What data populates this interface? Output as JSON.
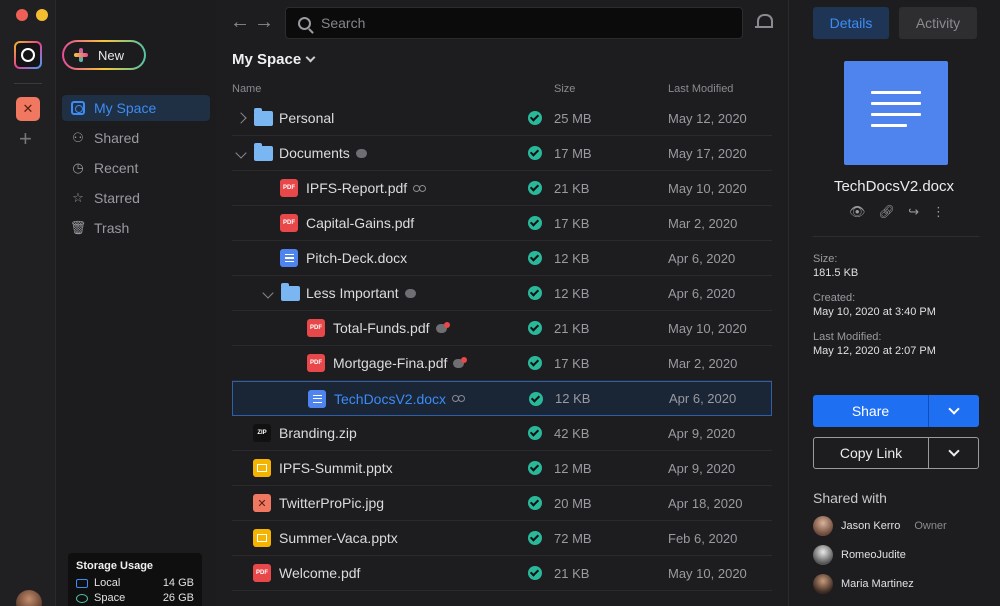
{
  "window": {
    "traffic_colors": [
      "#ee5f57",
      "#f4bd2f",
      "#30c84a"
    ]
  },
  "sidebar": {
    "new_label": "New",
    "items": [
      {
        "label": "My Space",
        "icon": "my-space-icon",
        "active": true
      },
      {
        "label": "Shared",
        "icon": "people-icon",
        "active": false
      },
      {
        "label": "Recent",
        "icon": "clock-icon",
        "active": false
      },
      {
        "label": "Starred",
        "icon": "star-icon",
        "active": false
      },
      {
        "label": "Trash",
        "icon": "trash-icon",
        "active": false
      }
    ],
    "storage": {
      "title": "Storage Usage",
      "rows": [
        {
          "label": "Local",
          "value": "14 GB"
        },
        {
          "label": "Space",
          "value": "26 GB"
        }
      ]
    }
  },
  "toolbar": {
    "search_placeholder": "Search"
  },
  "breadcrumb": {
    "title": "My Space"
  },
  "columns": {
    "name": "Name",
    "size": "Size",
    "modified": "Last Modified"
  },
  "files": [
    {
      "name": "Personal",
      "type": "folder",
      "indent": 0,
      "twisty": "closed",
      "size": "25 MB",
      "modified": "May 12, 2020"
    },
    {
      "name": "Documents",
      "type": "folder",
      "indent": 0,
      "twisty": "open",
      "badge": "comment",
      "size": "17 MB",
      "modified": "May 17, 2020"
    },
    {
      "name": "IPFS-Report.pdf",
      "type": "pdf",
      "indent": 1,
      "badge": "shared",
      "size": "21 KB",
      "modified": "May 10, 2020"
    },
    {
      "name": "Capital-Gains.pdf",
      "type": "pdf",
      "indent": 1,
      "size": "17 KB",
      "modified": "Mar 2, 2020"
    },
    {
      "name": "Pitch-Deck.docx",
      "type": "doc",
      "indent": 1,
      "size": "12 KB",
      "modified": "Apr 6, 2020"
    },
    {
      "name": "Less Important",
      "type": "folder",
      "indent": 1,
      "twisty": "open",
      "badge": "comment",
      "size": "12 KB",
      "modified": "Apr 6, 2020"
    },
    {
      "name": "Total-Funds.pdf",
      "type": "pdf",
      "indent": 2,
      "badge": "comment-alert",
      "size": "21 KB",
      "modified": "May 10, 2020"
    },
    {
      "name": "Mortgage-Fina.pdf",
      "type": "pdf",
      "indent": 2,
      "badge": "comment-alert",
      "size": "17 KB",
      "modified": "Mar 2, 2020"
    },
    {
      "name": "TechDocsV2.docx",
      "type": "doc",
      "indent": 2,
      "badge": "shared",
      "selected": true,
      "size": "12 KB",
      "modified": "Apr 6, 2020"
    },
    {
      "name": "Branding.zip",
      "type": "zip",
      "indent": 0,
      "size": "42 KB",
      "modified": "Apr 9, 2020"
    },
    {
      "name": "IPFS-Summit.pptx",
      "type": "ppt",
      "indent": 0,
      "size": "12 MB",
      "modified": "Apr 9, 2020"
    },
    {
      "name": "TwitterProPic.jpg",
      "type": "img",
      "indent": 0,
      "size": "20 MB",
      "modified": "Apr 18, 2020"
    },
    {
      "name": "Summer-Vaca.pptx",
      "type": "ppt",
      "indent": 0,
      "size": "72 MB",
      "modified": "Feb 6, 2020"
    },
    {
      "name": "Welcome.pdf",
      "type": "pdf",
      "indent": 0,
      "size": "21 KB",
      "modified": "May 10, 2020"
    }
  ],
  "details": {
    "tabs": {
      "details": "Details",
      "activity": "Activity"
    },
    "file_name": "TechDocsV2.docx",
    "size_label": "Size:",
    "size_value": "181.5 KB",
    "created_label": "Created:",
    "created_value": "May 10, 2020 at 3:40 PM",
    "modified_label": "Last Modified:",
    "modified_value": "May 12, 2020 at 2:07 PM",
    "share_label": "Share",
    "copy_label": "Copy Link",
    "shared_with_title": "Shared with",
    "people": [
      {
        "name": "Jason Kerro",
        "role": "Owner"
      },
      {
        "name": "RomeoJudite",
        "role": ""
      },
      {
        "name": "Maria Martinez",
        "role": ""
      }
    ]
  },
  "colors": {
    "accent": "#3d8cf5",
    "check": "#2ab89b",
    "share": "#1f6ff2"
  }
}
